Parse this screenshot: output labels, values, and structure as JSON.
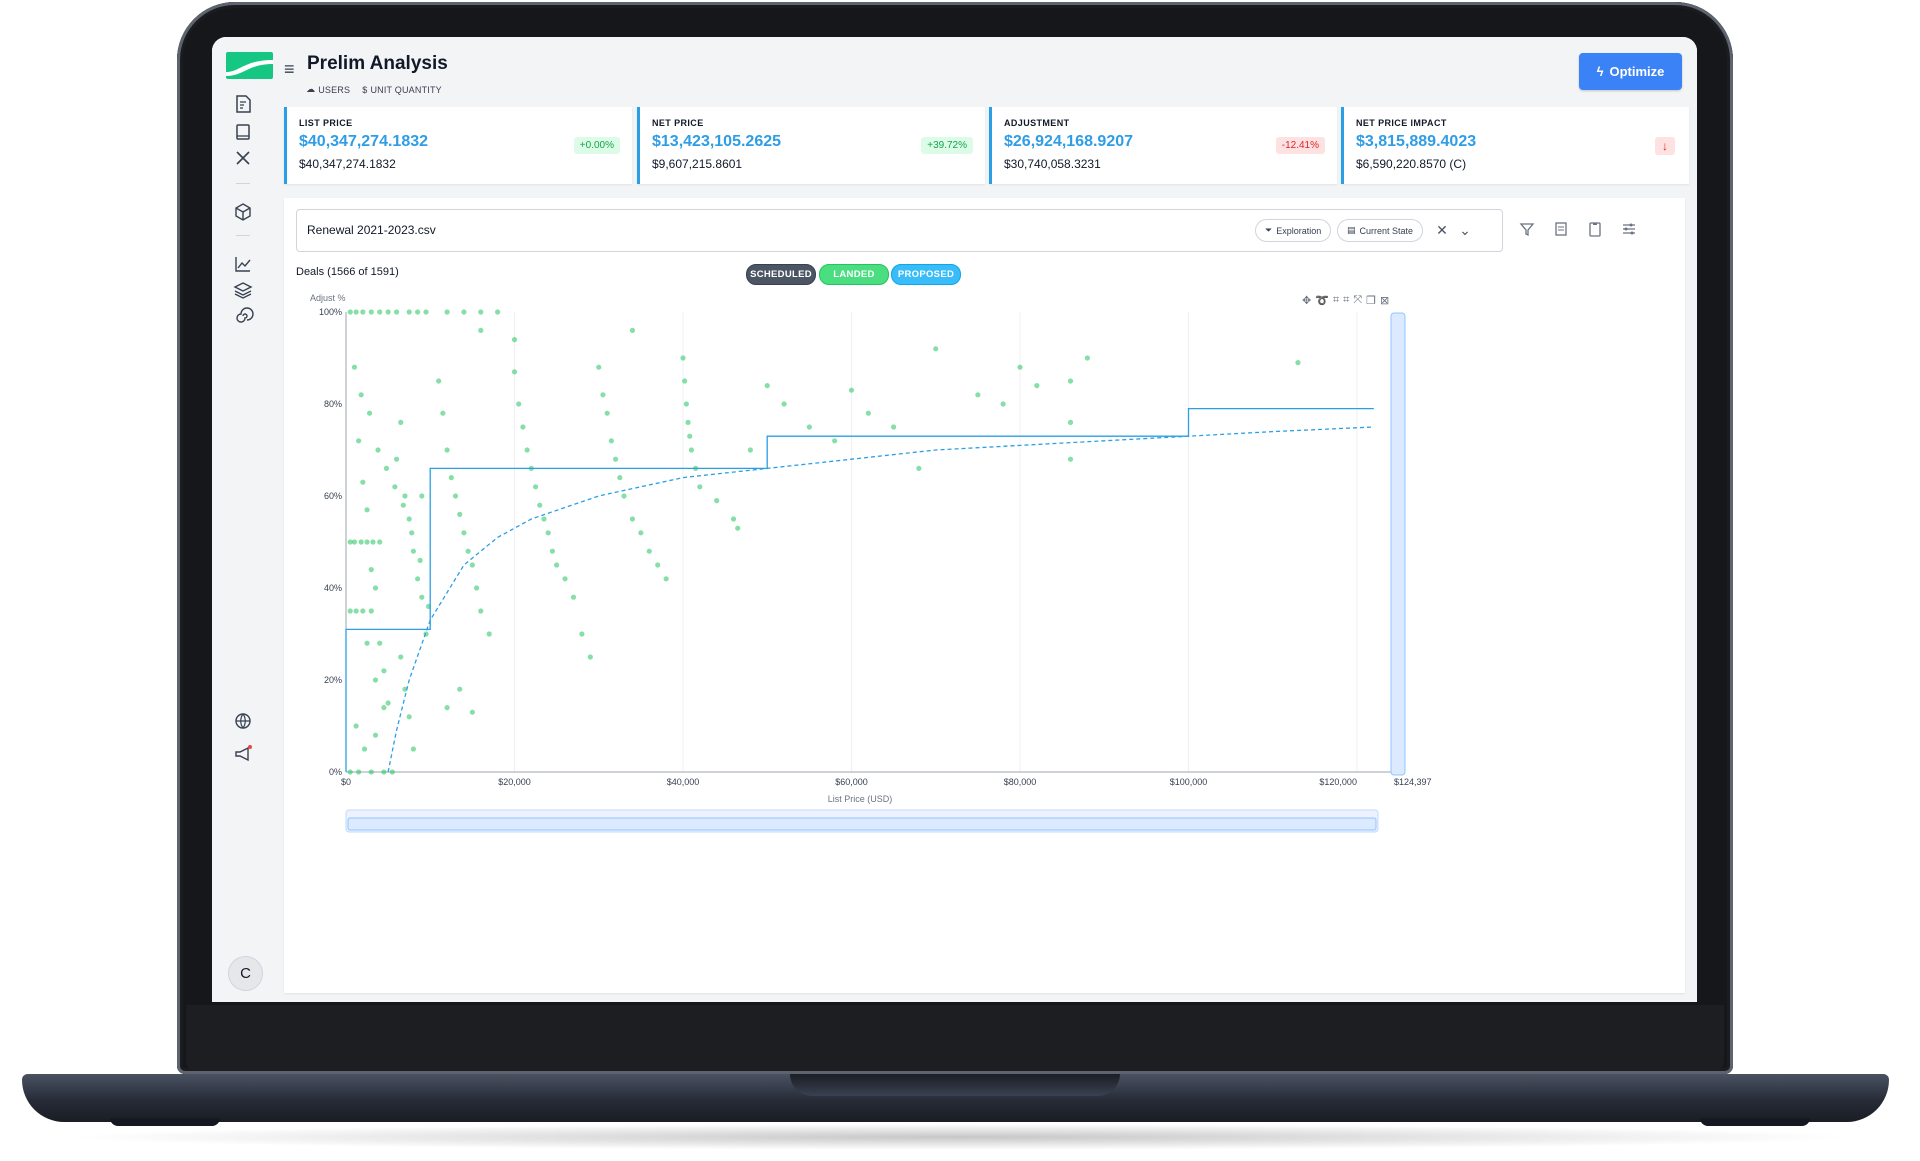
{
  "app": {
    "title": "Prelim Analysis",
    "tags": [
      "USERS",
      "UNIT QUANTITY"
    ],
    "optimize_label": "Optimize",
    "avatar_initial": "C"
  },
  "kpis": [
    {
      "label": "LIST PRICE",
      "value": "$40,347,274.1832",
      "sub": "$40,347,274.1832",
      "badge": "+0.00%",
      "badge_kind": "green"
    },
    {
      "label": "NET PRICE",
      "value": "$13,423,105.2625",
      "sub": "$9,607,215.8601",
      "badge": "+39.72%",
      "badge_kind": "green"
    },
    {
      "label": "ADJUSTMENT",
      "value": "$26,924,168.9207",
      "sub": "$30,740,058.3231",
      "badge": "-12.41%",
      "badge_kind": "red"
    },
    {
      "label": "NET PRICE IMPACT",
      "value": "$3,815,889.4023",
      "sub": "$6,590,220.8570 (C)",
      "badge": "↓",
      "badge_kind": "red-arrow"
    }
  ],
  "filebar": {
    "file_name": "Renewal 2021-2023.csv",
    "chip_exploration": "Exploration",
    "chip_current_state": "Current State"
  },
  "deals": {
    "count_label": "Deals (1566 of 1591)"
  },
  "legend_pills": {
    "scheduled": "SCHEDULED",
    "landed": "LANDED",
    "proposed": "PROPOSED"
  },
  "colors": {
    "accent": "#3b82f6",
    "kpi_value": "#2f9de6",
    "points": "#22c55e",
    "curve": "#2b9fe6"
  },
  "chart_data": {
    "type": "scatter",
    "title": "",
    "xlabel": "List Price (USD)",
    "ylabel": "Adjust %",
    "xlim": [
      0,
      124397
    ],
    "ylim": [
      0,
      100
    ],
    "x_ticks": [
      {
        "v": 0,
        "label": "$0"
      },
      {
        "v": 20000,
        "label": "$20,000"
      },
      {
        "v": 40000,
        "label": "$40,000"
      },
      {
        "v": 60000,
        "label": "$60,000"
      },
      {
        "v": 80000,
        "label": "$80,000"
      },
      {
        "v": 100000,
        "label": "$100,000"
      },
      {
        "v": 120000,
        "label": "$120,000"
      },
      {
        "v": 124397,
        "label": "$124,397"
      }
    ],
    "y_ticks": [
      {
        "v": 0,
        "label": "0%"
      },
      {
        "v": 20,
        "label": "20%"
      },
      {
        "v": 40,
        "label": "40%"
      },
      {
        "v": 60,
        "label": "60%"
      },
      {
        "v": 80,
        "label": "80%"
      },
      {
        "v": 100,
        "label": "100%"
      }
    ],
    "grid": "vertical",
    "series": [
      {
        "name": "",
        "kind": "step",
        "points": [
          [
            0,
            0
          ],
          [
            0,
            31
          ],
          [
            10000,
            31
          ],
          [
            10000,
            66
          ],
          [
            50000,
            66
          ],
          [
            50000,
            73
          ],
          [
            100000,
            73
          ],
          [
            100000,
            79
          ],
          [
            122000,
            79
          ]
        ]
      },
      {
        "name": "",
        "kind": "dashed-curve",
        "points": [
          [
            5000,
            0
          ],
          [
            6000,
            9
          ],
          [
            7500,
            20
          ],
          [
            10000,
            33
          ],
          [
            14000,
            45
          ],
          [
            18000,
            51
          ],
          [
            22000,
            55
          ],
          [
            30000,
            60
          ],
          [
            40000,
            64
          ],
          [
            50000,
            66
          ],
          [
            60000,
            68
          ],
          [
            70000,
            70
          ],
          [
            80000,
            71
          ],
          [
            90000,
            72
          ],
          [
            100000,
            73
          ],
          [
            110000,
            74
          ],
          [
            122000,
            75
          ]
        ]
      },
      {
        "name": "",
        "kind": "scatter",
        "points": [
          [
            500,
            100
          ],
          [
            1200,
            100
          ],
          [
            2000,
            100
          ],
          [
            3000,
            100
          ],
          [
            4000,
            100
          ],
          [
            5000,
            100
          ],
          [
            6000,
            100
          ],
          [
            7500,
            100
          ],
          [
            8500,
            100
          ],
          [
            9500,
            100
          ],
          [
            12000,
            100
          ],
          [
            14000,
            100
          ],
          [
            16000,
            100
          ],
          [
            18000,
            100
          ],
          [
            16000,
            96
          ],
          [
            20000,
            94
          ],
          [
            34000,
            96
          ],
          [
            500,
            50
          ],
          [
            1000,
            50
          ],
          [
            1800,
            50
          ],
          [
            2500,
            50
          ],
          [
            3200,
            50
          ],
          [
            4000,
            50
          ],
          [
            500,
            35
          ],
          [
            1200,
            35
          ],
          [
            2000,
            35
          ],
          [
            3000,
            35
          ],
          [
            500,
            0
          ],
          [
            1500,
            0
          ],
          [
            3000,
            0
          ],
          [
            4500,
            0
          ],
          [
            5500,
            0
          ],
          [
            1000,
            88
          ],
          [
            1500,
            72
          ],
          [
            2000,
            63
          ],
          [
            2500,
            57
          ],
          [
            3000,
            44
          ],
          [
            3500,
            40
          ],
          [
            4000,
            28
          ],
          [
            4500,
            22
          ],
          [
            5000,
            15
          ],
          [
            1200,
            10
          ],
          [
            2200,
            5
          ],
          [
            3500,
            8
          ],
          [
            6000,
            68
          ],
          [
            6500,
            76
          ],
          [
            7000,
            60
          ],
          [
            7500,
            55
          ],
          [
            8000,
            48
          ],
          [
            8500,
            42
          ],
          [
            9000,
            38
          ],
          [
            9500,
            30
          ],
          [
            6500,
            25
          ],
          [
            7000,
            18
          ],
          [
            7500,
            12
          ],
          [
            8000,
            5
          ],
          [
            9000,
            60
          ],
          [
            1800,
            82
          ],
          [
            2800,
            78
          ],
          [
            3800,
            70
          ],
          [
            4800,
            66
          ],
          [
            5800,
            62
          ],
          [
            6800,
            58
          ],
          [
            7800,
            52
          ],
          [
            8800,
            46
          ],
          [
            9800,
            36
          ],
          [
            2500,
            28
          ],
          [
            3500,
            20
          ],
          [
            4500,
            14
          ],
          [
            11000,
            85
          ],
          [
            11500,
            78
          ],
          [
            12000,
            70
          ],
          [
            12500,
            64
          ],
          [
            13000,
            60
          ],
          [
            13500,
            56
          ],
          [
            14000,
            52
          ],
          [
            14500,
            48
          ],
          [
            15000,
            45
          ],
          [
            15500,
            40
          ],
          [
            16000,
            35
          ],
          [
            17000,
            30
          ],
          [
            12000,
            14
          ],
          [
            13500,
            18
          ],
          [
            15000,
            13
          ],
          [
            20000,
            87
          ],
          [
            20500,
            80
          ],
          [
            21000,
            75
          ],
          [
            21500,
            70
          ],
          [
            22000,
            66
          ],
          [
            22500,
            62
          ],
          [
            23000,
            58
          ],
          [
            23500,
            55
          ],
          [
            24000,
            52
          ],
          [
            24500,
            48
          ],
          [
            25000,
            45
          ],
          [
            26000,
            42
          ],
          [
            27000,
            38
          ],
          [
            28000,
            30
          ],
          [
            29000,
            25
          ],
          [
            30000,
            88
          ],
          [
            30500,
            82
          ],
          [
            31000,
            78
          ],
          [
            31500,
            72
          ],
          [
            32000,
            68
          ],
          [
            32500,
            64
          ],
          [
            33000,
            60
          ],
          [
            34000,
            55
          ],
          [
            35000,
            52
          ],
          [
            36000,
            48
          ],
          [
            37000,
            45
          ],
          [
            38000,
            42
          ],
          [
            40000,
            90
          ],
          [
            40200,
            85
          ],
          [
            40400,
            80
          ],
          [
            40600,
            76
          ],
          [
            40800,
            73
          ],
          [
            41000,
            70
          ],
          [
            41500,
            66
          ],
          [
            42000,
            62
          ],
          [
            44000,
            59
          ],
          [
            46000,
            55
          ],
          [
            46500,
            53
          ],
          [
            48000,
            70
          ],
          [
            50000,
            84
          ],
          [
            52000,
            80
          ],
          [
            55000,
            75
          ],
          [
            58000,
            72
          ],
          [
            60000,
            83
          ],
          [
            62000,
            78
          ],
          [
            65000,
            75
          ],
          [
            68000,
            66
          ],
          [
            70000,
            92
          ],
          [
            75000,
            82
          ],
          [
            78000,
            80
          ],
          [
            80000,
            88
          ],
          [
            82000,
            84
          ],
          [
            86000,
            85
          ],
          [
            86000,
            76
          ],
          [
            86000,
            68
          ],
          [
            88000,
            90
          ],
          [
            113000,
            89
          ]
        ]
      }
    ]
  }
}
